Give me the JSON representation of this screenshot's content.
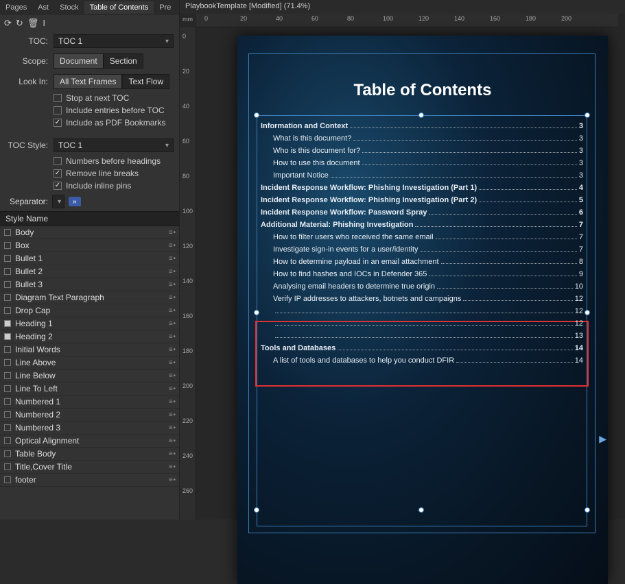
{
  "tabs": [
    "Pages",
    "Ast",
    "Stock",
    "Table of Contents",
    "Pre"
  ],
  "activeTab": 3,
  "form": {
    "toc_label": "TOC:",
    "toc_value": "TOC 1",
    "scope_label": "Scope:",
    "scope_opts": [
      "Document",
      "Section"
    ],
    "lookin_label": "Look In:",
    "lookin_opts": [
      "All Text Frames",
      "Text Flow"
    ],
    "chk_stop": "Stop at next TOC",
    "chk_before": "Include entries before TOC",
    "chk_pdf": "Include as PDF Bookmarks",
    "tocstyle_label": "TOC Style:",
    "tocstyle_value": "TOC 1",
    "chk_numbers": "Numbers before headings",
    "chk_removelb": "Remove line breaks",
    "chk_inline": "Include inline pins",
    "sep_label": "Separator:",
    "sep_arrow": "»"
  },
  "styles_header": "Style Name",
  "styles": [
    {
      "n": "Body",
      "on": false
    },
    {
      "n": "Box",
      "on": false
    },
    {
      "n": "Bullet 1",
      "on": false
    },
    {
      "n": "Bullet 2",
      "on": false
    },
    {
      "n": "Bullet 3",
      "on": false
    },
    {
      "n": "Diagram Text Paragraph",
      "on": false
    },
    {
      "n": "Drop Cap",
      "on": false
    },
    {
      "n": "Heading 1",
      "on": true
    },
    {
      "n": "Heading 2",
      "on": true
    },
    {
      "n": "Initial Words",
      "on": false
    },
    {
      "n": "Line Above",
      "on": false
    },
    {
      "n": "Line Below",
      "on": false
    },
    {
      "n": "Line To Left",
      "on": false
    },
    {
      "n": "Numbered 1",
      "on": false
    },
    {
      "n": "Numbered 2",
      "on": false
    },
    {
      "n": "Numbered 3",
      "on": false
    },
    {
      "n": "Optical Alignment",
      "on": false
    },
    {
      "n": "Table Body",
      "on": false
    },
    {
      "n": "Title,Cover Title",
      "on": false
    },
    {
      "n": "footer",
      "on": false
    }
  ],
  "doc_tab": "PlaybookTemplate [Modified] (71.4%)",
  "ruler_unit": "mm",
  "hruler": [
    0,
    20,
    40,
    60,
    80,
    100,
    120,
    140,
    160,
    180,
    200
  ],
  "vruler": [
    0,
    20,
    40,
    60,
    80,
    100,
    120,
    140,
    160,
    180,
    200,
    220,
    240,
    260
  ],
  "page_title": "Table of Contents",
  "toc": [
    {
      "l": 1,
      "t": "Information and Context",
      "p": "3"
    },
    {
      "l": 2,
      "t": "What is this document?",
      "p": "3"
    },
    {
      "l": 2,
      "t": "Who is this document for?",
      "p": "3"
    },
    {
      "l": 2,
      "t": "How to use this document",
      "p": "3"
    },
    {
      "l": 2,
      "t": "Important Notice",
      "p": "3"
    },
    {
      "l": 1,
      "t": "Incident Response Workflow: Phishing Investigation (Part 1)",
      "p": "4"
    },
    {
      "l": 1,
      "t": "Incident Response Workflow: Phishing Investigation (Part 2)",
      "p": "5"
    },
    {
      "l": 1,
      "t": "Incident Response Workflow: Password Spray",
      "p": "6"
    },
    {
      "l": 1,
      "t": "Additional Material: Phishing Investigation",
      "p": "7"
    },
    {
      "l": 2,
      "t": "How to filter users who received the same email",
      "p": "7"
    },
    {
      "l": 2,
      "t": "Investigate sign-in events for a user/identity",
      "p": "7"
    },
    {
      "l": 2,
      "t": "How to determine payload in an email attachment",
      "p": "8"
    },
    {
      "l": 2,
      "t": "How to find hashes and IOCs in Defender 365",
      "p": "9"
    },
    {
      "l": 2,
      "t": "Analysing email headers to determine true origin",
      "p": "10"
    },
    {
      "l": 2,
      "t": "Verify IP addresses to attackers, botnets and campaigns",
      "p": "12"
    },
    {
      "l": 2,
      "t": "",
      "p": "12"
    },
    {
      "l": 2,
      "t": "",
      "p": "12"
    },
    {
      "l": 2,
      "t": "",
      "p": "13"
    },
    {
      "l": 1,
      "t": "Tools and Databases",
      "p": "14"
    },
    {
      "l": 2,
      "t": "A list of tools and databases to help you conduct DFIR",
      "p": "14"
    }
  ]
}
